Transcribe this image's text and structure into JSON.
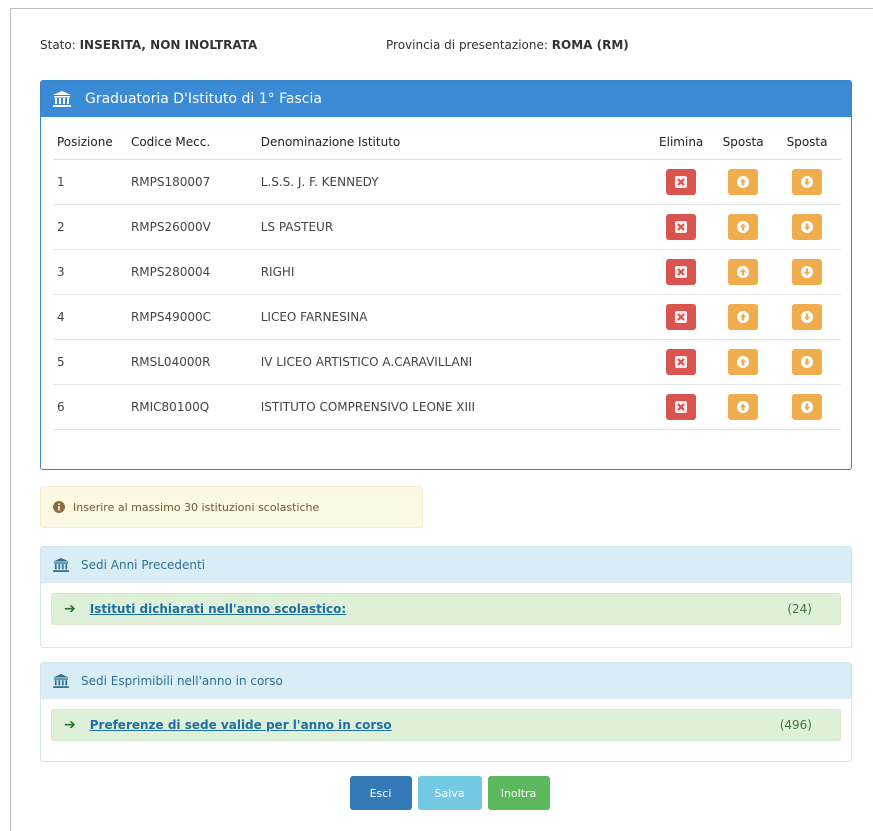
{
  "status": {
    "label": "Stato:",
    "value": "INSERITA, NON INOLTRATA"
  },
  "provincia": {
    "label": "Provincia di presentazione:",
    "value": "ROMA (RM)"
  },
  "main_panel": {
    "title": "Graduatoria D'Istituto di 1° Fascia",
    "columns": [
      "Posizione",
      "Codice Mecc.",
      "Denominazione Istituto",
      "Elimina",
      "Sposta",
      "Sposta"
    ],
    "rows": [
      {
        "pos": "1",
        "code": "RMPS180007",
        "name": "L.S.S. J. F. KENNEDY"
      },
      {
        "pos": "2",
        "code": "RMPS26000V",
        "name": "LS PASTEUR"
      },
      {
        "pos": "3",
        "code": "RMPS280004",
        "name": "RIGHI"
      },
      {
        "pos": "4",
        "code": "RMPS49000C",
        "name": "LICEO FARNESINA"
      },
      {
        "pos": "5",
        "code": "RMSL04000R",
        "name": "IV LICEO ARTISTICO A.CARAVILLANI"
      },
      {
        "pos": "6",
        "code": "RMIC80100Q",
        "name": "ISTITUTO COMPRENSIVO LEONE XIII"
      }
    ]
  },
  "alert": {
    "text": "Inserire al massimo 30 istituzioni scolastiche"
  },
  "prev_panel": {
    "title": "Sedi Anni Precedenti",
    "link": "Istituti dichiarati nell'anno scolastico:",
    "count": "(24)"
  },
  "current_panel": {
    "title": "Sedi Esprimibili nell'anno in corso",
    "link": "Preferenze di sede valide per l'anno in corso",
    "count": "(496)"
  },
  "buttons": {
    "esci": "Esci",
    "salva": "Salva",
    "inoltra": "Inoltra"
  },
  "colors": {
    "primary": "#3b8ad5",
    "danger": "#d9534f",
    "warning": "#f0ad4e",
    "success": "#5cb85c",
    "info": "#5bc0de"
  }
}
